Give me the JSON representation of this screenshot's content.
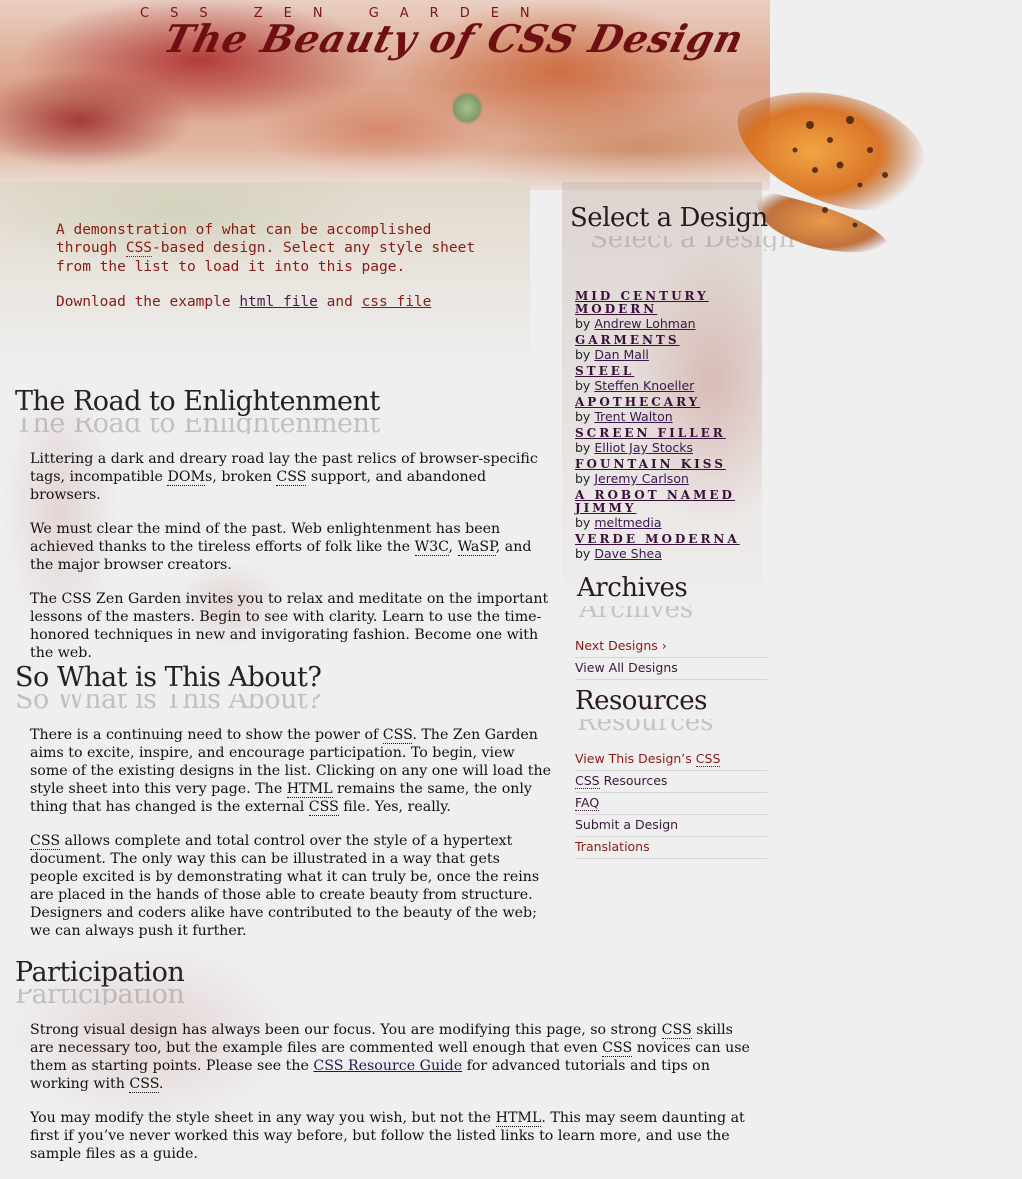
{
  "header": {
    "site_name": "CSS ZEN GARDEN",
    "tagline": "The Beauty of CSS Design"
  },
  "intro": {
    "summary_before": "A demonstration of what can be accomplished through ",
    "summary_abbr": "CSS",
    "summary_after": "-based design. Select any style sheet from the list to load it into this page.",
    "download_prefix": "Download the example ",
    "html_link": "html file",
    "download_and": " and ",
    "css_link": "css file"
  },
  "sections": {
    "road": {
      "title": "The Road to Enlightenment",
      "p1_a": "Littering a dark and dreary road lay the past relics of browser-specific tags, incompatible ",
      "p1_abbr1": "DOM",
      "p1_b": "s, broken ",
      "p1_abbr2": "CSS",
      "p1_c": " support, and abandoned browsers.",
      "p2_a": "We must clear the mind of the past. Web enlightenment has been achieved thanks to the tireless efforts of folk like the ",
      "p2_abbr1": "W3C",
      "p2_b": ", ",
      "p2_abbr2": "WaSP",
      "p2_c": ", and the major browser creators.",
      "p3": "The CSS Zen Garden invites you to relax and meditate on the important lessons of the masters. Begin to see with clarity. Learn to use the time-honored techniques in new and invigorating fashion. Become one with the web."
    },
    "about": {
      "title": "So What is This About?",
      "p1_a": "There is a continuing need to show the power of ",
      "p1_abbr1": "CSS",
      "p1_b": ". The Zen Garden aims to excite, inspire, and encourage participation. To begin, view some of the existing designs in the list. Clicking on any one will load the style sheet into this very page. The ",
      "p1_abbr2": "HTML",
      "p1_c": " remains the same, the only thing that has changed is the external ",
      "p1_abbr3": "CSS",
      "p1_d": " file. Yes, really.",
      "p2_abbr": "CSS",
      "p2_rest": " allows complete and total control over the style of a hypertext document. The only way this can be illustrated in a way that gets people excited is by demonstrating what it can truly be, once the reins are placed in the hands of those able to create beauty from structure. Designers and coders alike have contributed to the beauty of the web; we can always push it further."
    },
    "participation": {
      "title": "Participation",
      "p1_a": "Strong visual design has always been our focus. You are modifying this page, so strong ",
      "p1_abbr1": "CSS",
      "p1_b": " skills are necessary too, but the example files are commented well enough that even ",
      "p1_abbr2": "CSS",
      "p1_c": " novices can use them as starting points. Please see the ",
      "p1_link": "CSS Resource Guide",
      "p1_d": " for advanced tutorials and tips on working with ",
      "p1_abbr3": "CSS",
      "p1_e": ".",
      "p2_a": "You may modify the style sheet in any way you wish, but not the ",
      "p2_abbr": "HTML",
      "p2_b": ". This may seem daunting at first if you’ve never worked this way before, but follow the listed links to learn more, and use the sample files as a guide."
    }
  },
  "sidebar": {
    "select_title": "Select a Design",
    "by_label": "by",
    "designs": [
      {
        "name": "Mid Century Modern",
        "author": "Andrew Lohman"
      },
      {
        "name": "Garments",
        "author": "Dan Mall"
      },
      {
        "name": "Steel",
        "author": "Steffen Knoeller"
      },
      {
        "name": "Apothecary",
        "author": "Trent Walton"
      },
      {
        "name": "Screen Filler",
        "author": "Elliot Jay Stocks"
      },
      {
        "name": "Fountain Kiss",
        "author": "Jeremy Carlson"
      },
      {
        "name": "A Robot Named Jimmy",
        "author": "meltmedia"
      },
      {
        "name": "Verde Moderna",
        "author": "Dave Shea"
      }
    ],
    "archives_title": "Archives",
    "archives": {
      "next": "Next Designs ›",
      "view_all": "View All Designs"
    },
    "resources_title": "Resources",
    "resources": {
      "view_css_prefix": "View This Design’s ",
      "view_css_abbr": "CSS",
      "css_resources_abbr": "CSS",
      "css_resources_rest": " Resources",
      "faq_abbr": "FAQ",
      "submit": "Submit a Design",
      "translations": "Translations"
    }
  },
  "colors": {
    "page_bg": "#efefef",
    "accent_red": "#8b1a14",
    "accent_purple": "#3a0f3a"
  }
}
